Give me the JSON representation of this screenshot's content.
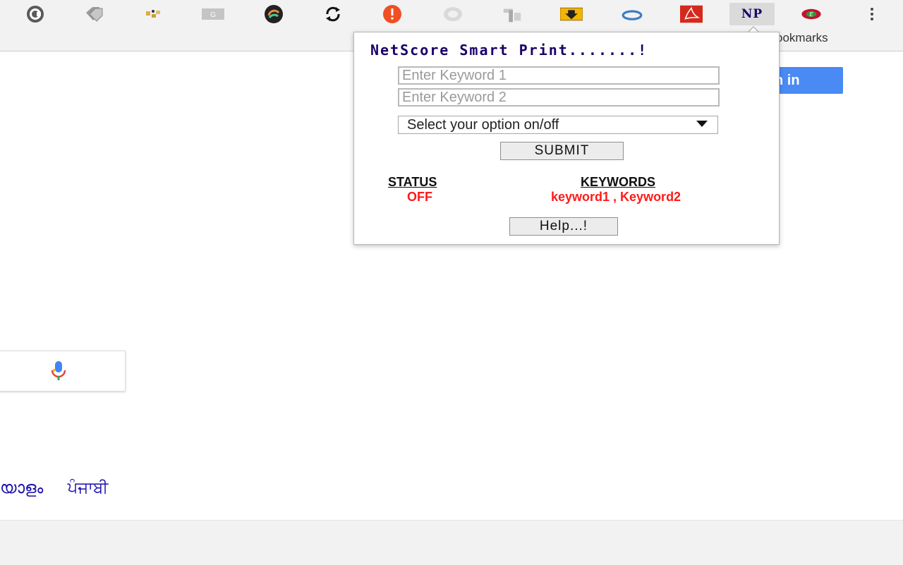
{
  "toolbar": {
    "extensions": [
      {
        "icon": "copyright-c-icon",
        "color": "#555555"
      },
      {
        "icon": "price-tags-icon",
        "color": "#8a8a8a"
      },
      {
        "icon": "puzzle-bits-icon",
        "color": "#d6a23a"
      },
      {
        "icon": "grammar-g-icon",
        "color": "#b5b5b5"
      },
      {
        "icon": "color-wheel-icon",
        "color": "#222222"
      },
      {
        "icon": "sync-arrows-icon",
        "color": "#111111"
      },
      {
        "icon": "alert-exclamation-icon",
        "color": "#f04e23"
      },
      {
        "icon": "ghost-circle-icon",
        "color": "#cfcfcf"
      },
      {
        "icon": "tools-icon",
        "color": "#9e9e9e"
      },
      {
        "icon": "download-arrow-icon",
        "color": "#f5b400"
      },
      {
        "icon": "ring-icon",
        "color": "#3d7ec0"
      },
      {
        "icon": "pdf-icon",
        "color": "#d42a1e"
      },
      {
        "icon": "netscore-np-icon",
        "color": "#1a0066"
      },
      {
        "icon": "globe-badge-icon",
        "color": "#c8102e"
      }
    ],
    "np_label": "NP",
    "bookmarks_label": "ookmarks"
  },
  "page": {
    "signin_label": "n in",
    "languages": [
      "യാളം",
      "ਪੰਜਾਬੀ"
    ]
  },
  "popup": {
    "title": "NetScore Smart Print.......!",
    "keyword1_placeholder": "Enter Keyword 1",
    "keyword2_placeholder": "Enter Keyword 2",
    "select_value": "Select your option on/off",
    "submit_label": "SUBMIT",
    "status_heading": "STATUS",
    "keywords_heading": "KEYWORDS",
    "status_value": "OFF",
    "keywords_value": "keyword1 , Keyword2",
    "help_label": "Help...!"
  },
  "colors": {
    "accent_red": "#ff1a1a",
    "title_navy": "#1a0066",
    "signin_blue": "#4a8af4"
  }
}
